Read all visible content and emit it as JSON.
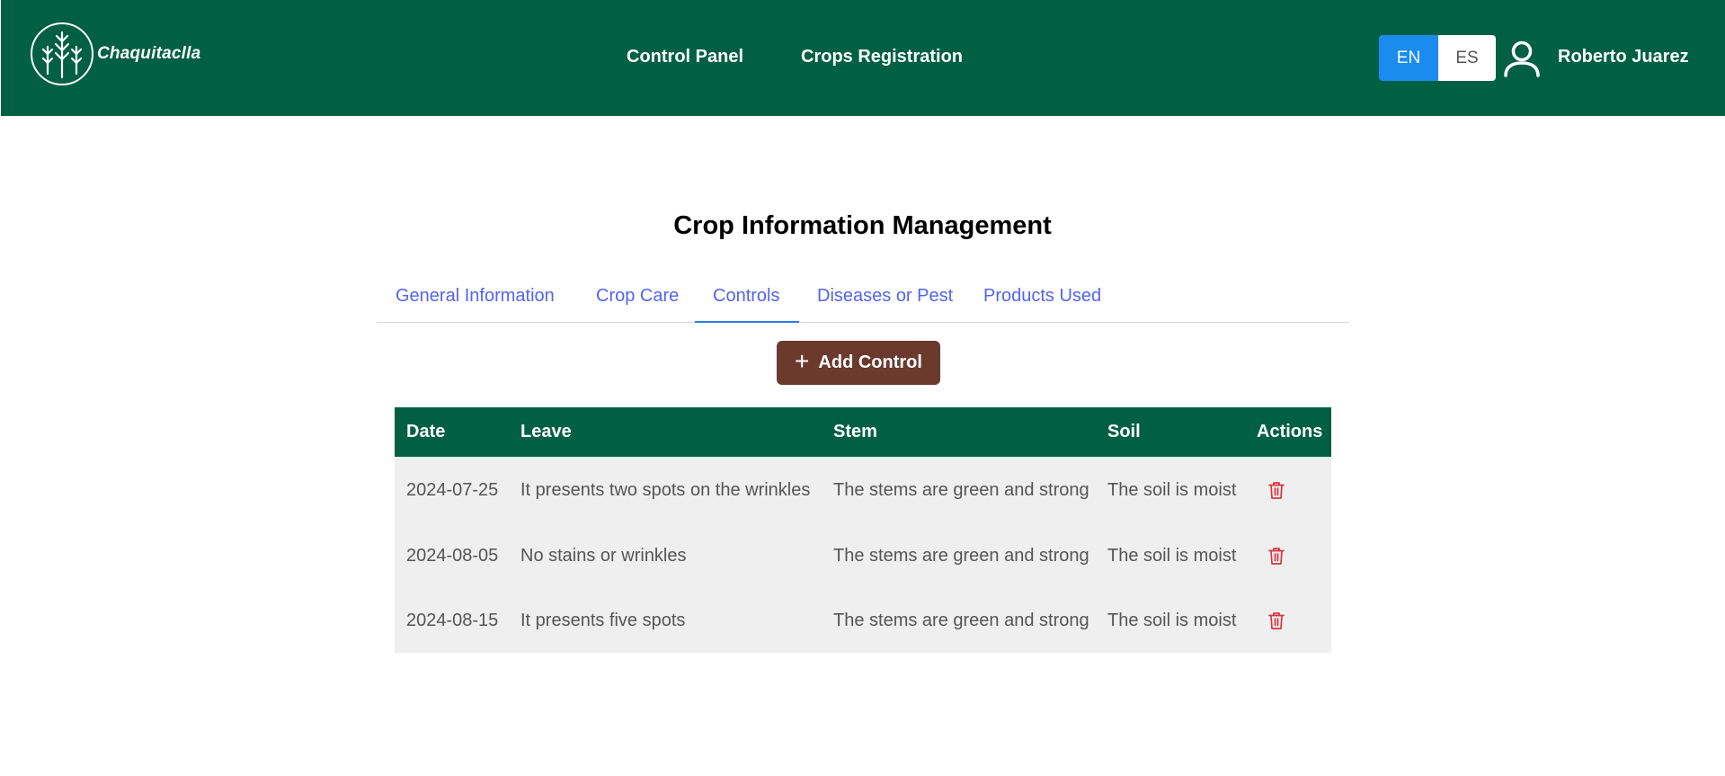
{
  "header": {
    "logo_text": "Chaquitaclla",
    "nav": {
      "control_panel": "Control Panel",
      "crops_registration": "Crops Registration"
    },
    "languages": {
      "en": "EN",
      "es": "ES",
      "selected": "EN"
    },
    "user_name": "Roberto Juarez"
  },
  "main": {
    "title": "Crop Information Management",
    "tabs": [
      {
        "label": "General Information"
      },
      {
        "label": "Crop Care"
      },
      {
        "label": "Controls",
        "active": true
      },
      {
        "label": "Diseases or Pest"
      },
      {
        "label": "Products Used"
      }
    ],
    "add_button_label": "Add Control",
    "table": {
      "headers": {
        "date": "Date",
        "leave": "Leave",
        "stem": "Stem",
        "soil": "Soil",
        "actions": "Actions"
      },
      "rows": [
        {
          "date": "2024-07-25",
          "leave": "It presents two spots on the wrinkles",
          "stem": "The stems are green and strong",
          "soil": "The soil is moist"
        },
        {
          "date": "2024-08-05",
          "leave": "No stains or wrinkles",
          "stem": "The stems are green and strong",
          "soil": "The soil is moist"
        },
        {
          "date": "2024-08-15",
          "leave": "It presents five spots",
          "stem": "The stems are green and strong",
          "soil": "The soil is moist"
        }
      ]
    }
  },
  "colors": {
    "header_bg": "#016042",
    "accent_blue": "#1a8cf0",
    "tab_text": "#5264f0",
    "add_button": "#6b3a2c",
    "delete_icon": "#d9363e"
  }
}
